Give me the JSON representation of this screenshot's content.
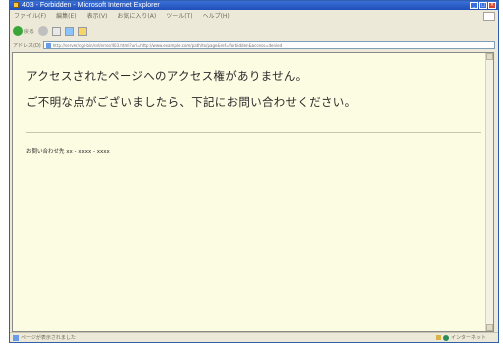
{
  "window": {
    "title": "403 - Forbidden - Microsoft Internet Explorer"
  },
  "menubar": {
    "items": [
      "ファイル(F)",
      "編集(E)",
      "表示(V)",
      "お気に入り(A)",
      "ツール(T)",
      "ヘルプ(H)"
    ]
  },
  "toolbar": {
    "back_label": "戻る",
    "forward_label": "▸"
  },
  "addressbar": {
    "label": "アドレス(D)",
    "url": "http://server/cgi-bin/ssl/error/403.html?url=http://www.example.com/path/to/page&ref=forbidden&access=denied"
  },
  "page": {
    "message_line1": "アクセスされたページへのアクセス権がありません。",
    "message_line2": "ご不明な点がございましたら、下記にお問い合わせください。",
    "contact": "お問い合わせ先 xx - xxxx - xxxx"
  },
  "statusbar": {
    "text": "ページが表示されました",
    "zone": "インターネット"
  }
}
